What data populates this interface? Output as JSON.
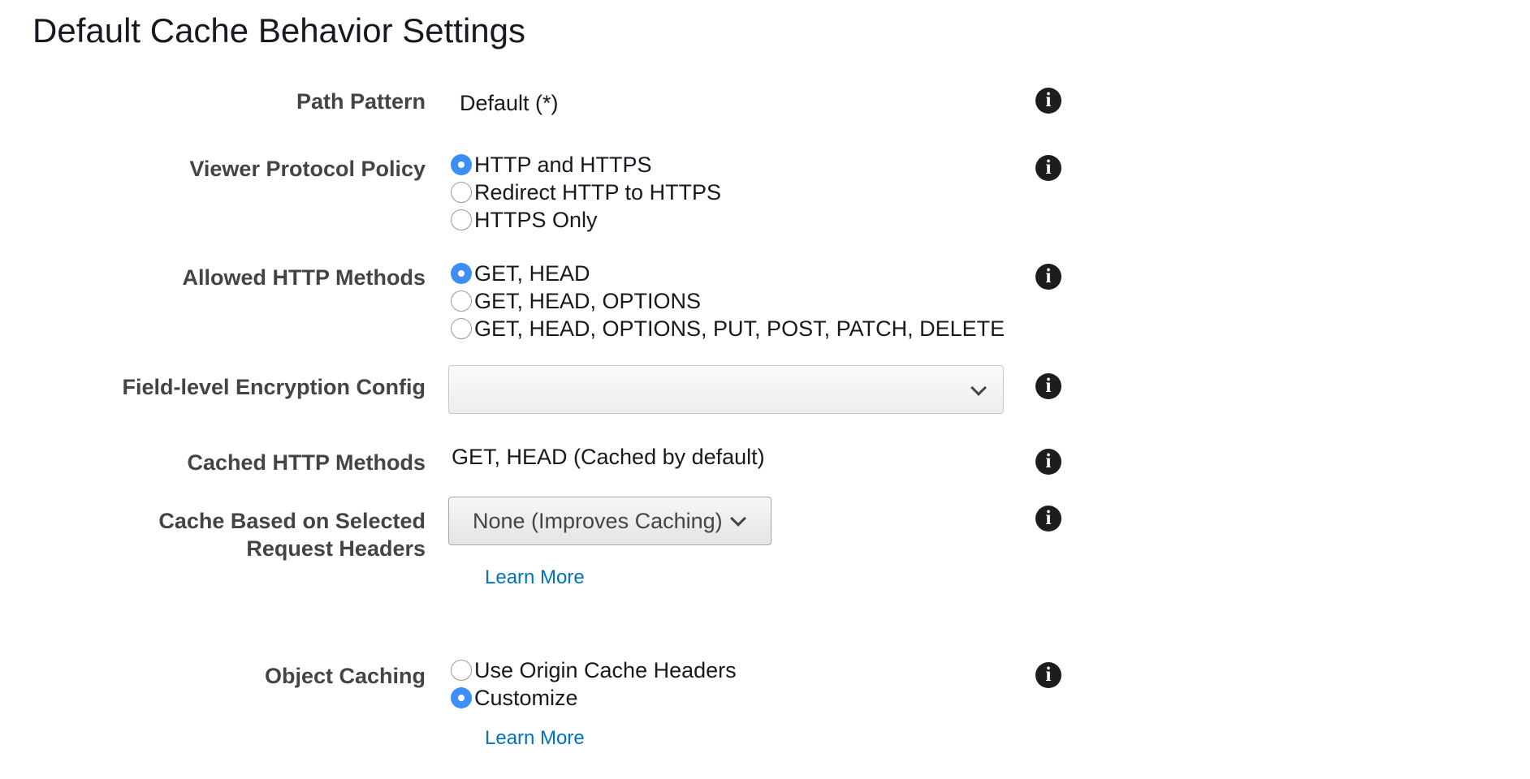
{
  "section_title": "Default Cache Behavior Settings",
  "path_pattern": {
    "label": "Path Pattern",
    "value": "Default (*)"
  },
  "viewer_protocol_policy": {
    "label": "Viewer Protocol Policy",
    "options": [
      {
        "label": "HTTP and HTTPS",
        "checked": true
      },
      {
        "label": "Redirect HTTP to HTTPS",
        "checked": false
      },
      {
        "label": "HTTPS Only",
        "checked": false
      }
    ]
  },
  "allowed_http_methods": {
    "label": "Allowed HTTP Methods",
    "options": [
      {
        "label": "GET, HEAD",
        "checked": true
      },
      {
        "label": "GET, HEAD, OPTIONS",
        "checked": false
      },
      {
        "label": "GET, HEAD, OPTIONS, PUT, POST, PATCH, DELETE",
        "checked": false
      }
    ]
  },
  "field_level_encryption": {
    "label": "Field-level Encryption Config",
    "value": ""
  },
  "cached_http_methods": {
    "label": "Cached HTTP Methods",
    "value": "GET, HEAD (Cached by default)"
  },
  "cache_headers": {
    "label_line1": "Cache Based on Selected",
    "label_line2": "Request Headers",
    "selected": "None (Improves Caching)",
    "learn_more": "Learn More"
  },
  "object_caching": {
    "label": "Object Caching",
    "options": [
      {
        "label": "Use Origin Cache Headers",
        "checked": false
      },
      {
        "label": "Customize",
        "checked": true
      }
    ],
    "learn_more": "Learn More"
  },
  "icons": {
    "info": "info-icon",
    "dropdown": "chevron-down-icon"
  },
  "colors": {
    "radio_checked": "#3d8ef5",
    "link": "#0073bb",
    "label": "#444444"
  }
}
